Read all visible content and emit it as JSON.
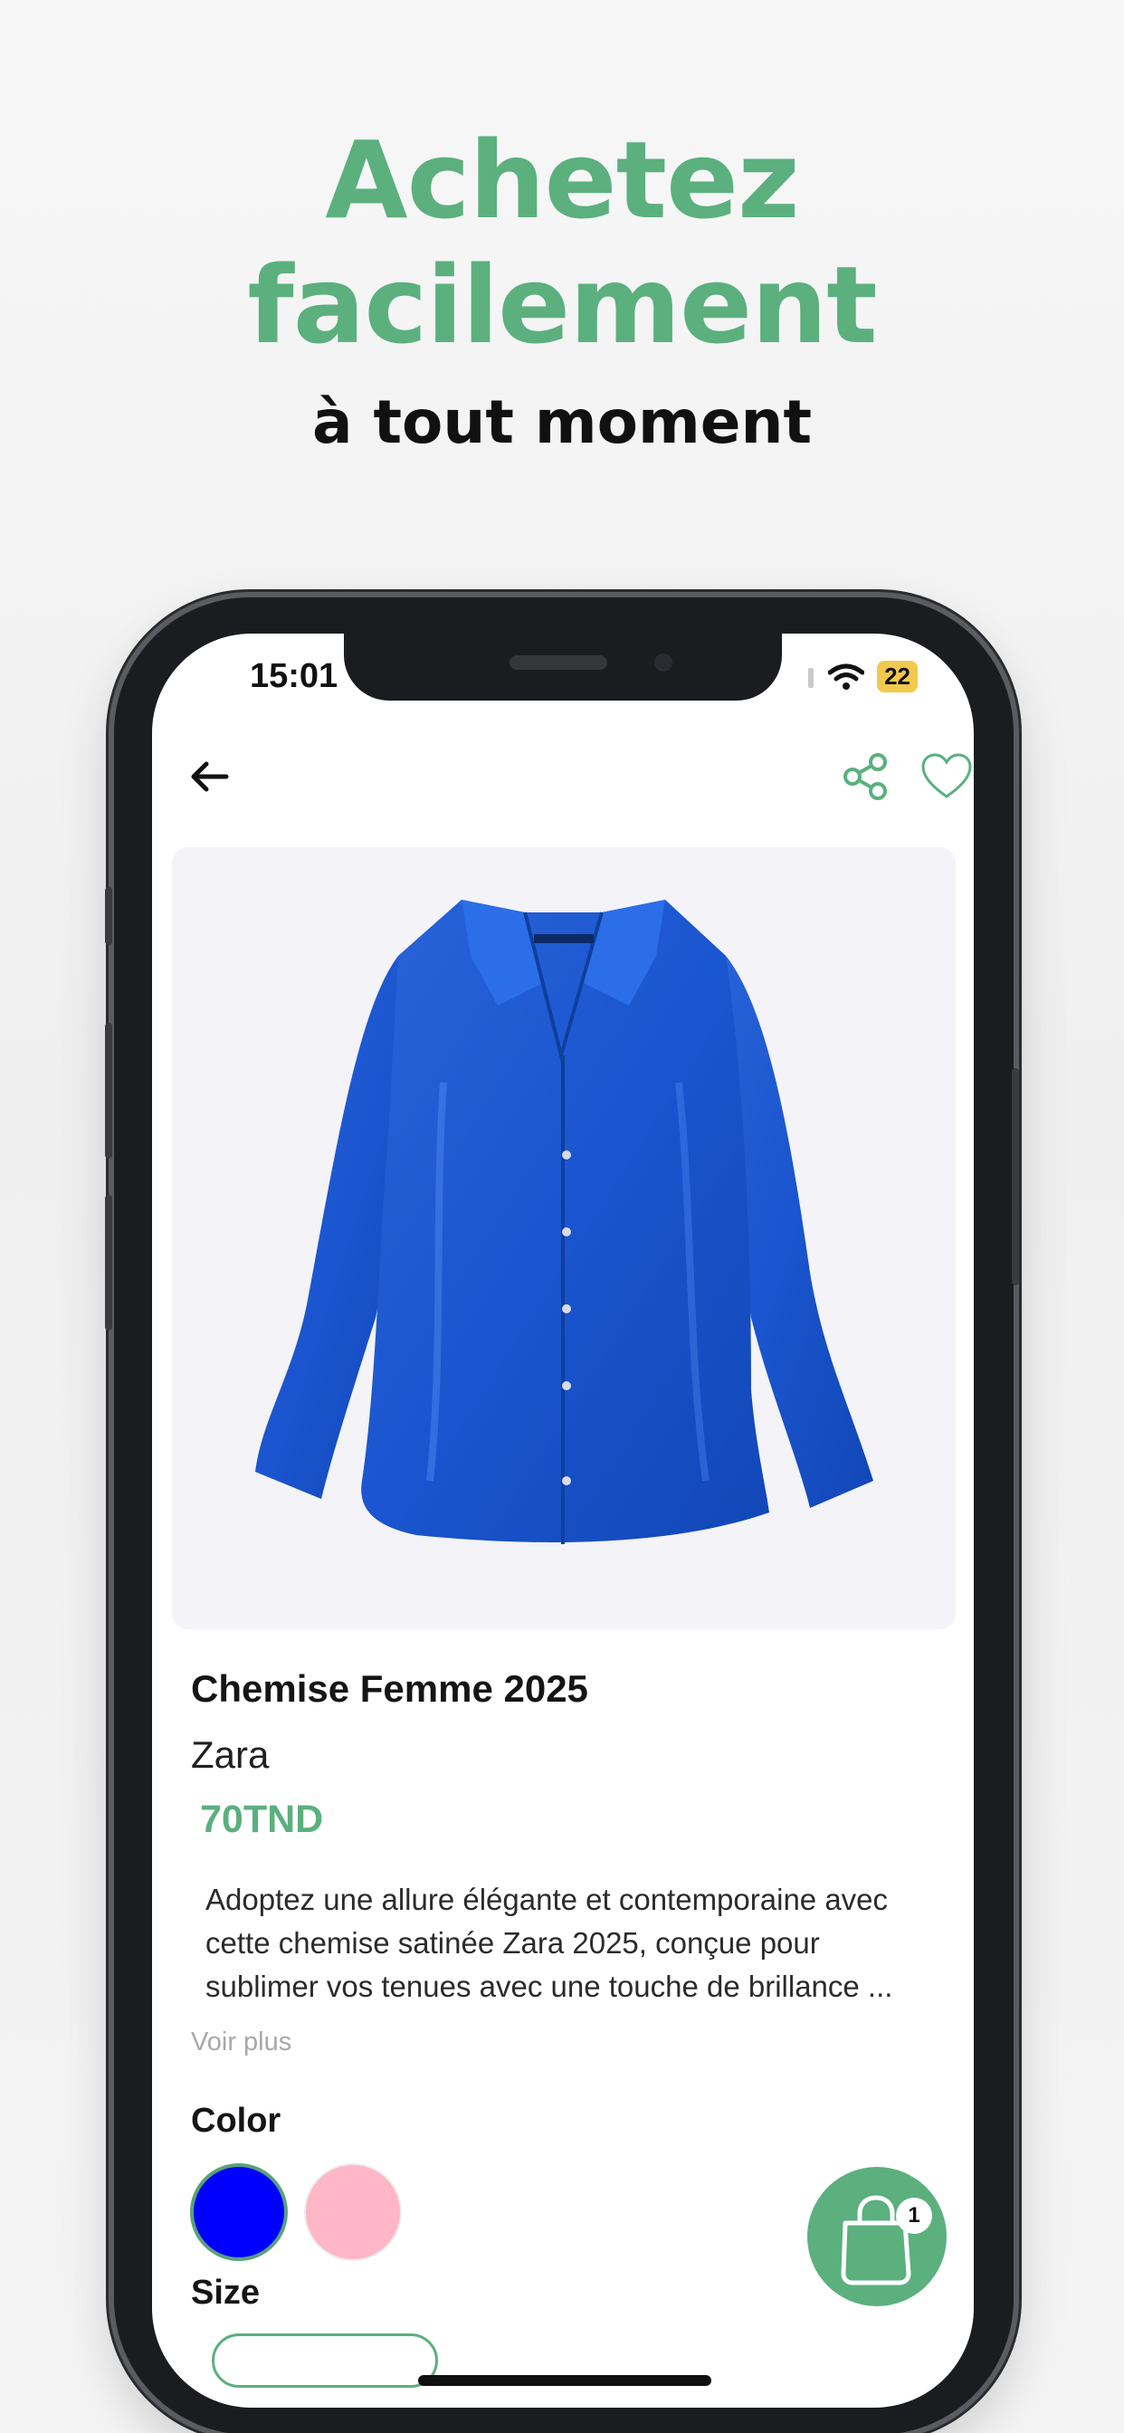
{
  "promo": {
    "headline_line1": "Achetez",
    "headline_line2": "facilement",
    "subline": "à tout moment"
  },
  "status_bar": {
    "time": "15:01",
    "battery": "22"
  },
  "product": {
    "name": "Chemise Femme 2025",
    "brand": "Zara",
    "price": "70TND",
    "description": "Adoptez une allure élégante et contemporaine avec cette chemise satinée Zara 2025, conçue pour sublimer vos tenues avec une touche de brillance ...",
    "see_more": "Voir plus"
  },
  "options": {
    "color_label": "Color",
    "colors": [
      {
        "name": "blue",
        "hex": "#0000FF",
        "selected": true
      },
      {
        "name": "pink",
        "hex": "#FFB6C6",
        "selected": false
      }
    ],
    "size_label": "Size"
  },
  "cart": {
    "count": "1"
  },
  "theme": {
    "accent": "#5BB07E"
  },
  "icons": [
    "back-arrow-icon",
    "share-icon",
    "heart-icon",
    "shopping-bag-icon",
    "wifi-icon",
    "signal-icon"
  ]
}
